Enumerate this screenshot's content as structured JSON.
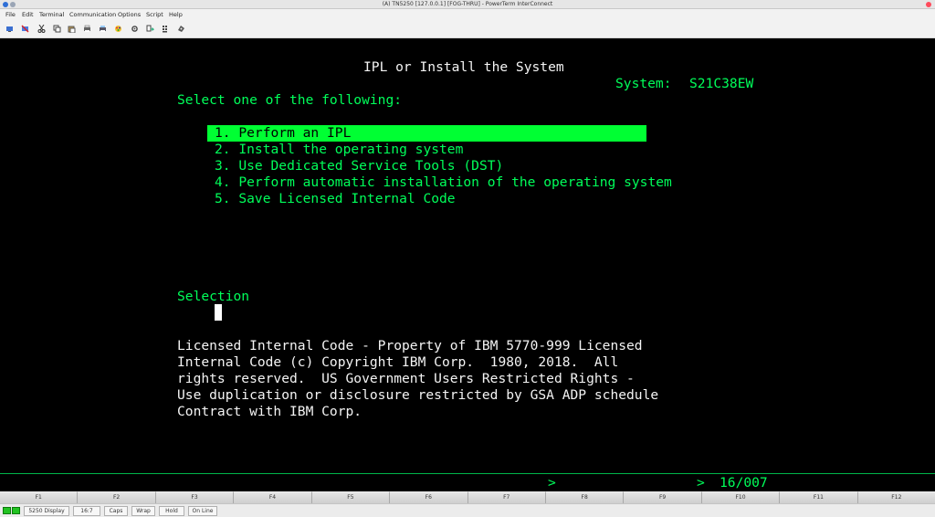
{
  "window": {
    "title": "(A) TN5250 [127.0.0.1] [FOG-THRU] - PowerTerm InterConnect"
  },
  "menu": [
    "File",
    "Edit",
    "Terminal",
    "Communication",
    "Options",
    "Script",
    "Help"
  ],
  "toolbar": {
    "icons": [
      "connect-icon",
      "disconnect-icon",
      "cut-icon",
      "copy-icon",
      "paste-icon",
      "print-icon",
      "print-screen-icon",
      "color-icon",
      "settings-icon",
      "file-transfer-icon",
      "keypad-icon",
      "macro-icon"
    ]
  },
  "screen": {
    "title": "IPL or Install the System",
    "system_label": "System:",
    "system_name": "S21C38EW",
    "prompt": "Select one of the following:",
    "options": [
      "1. Perform an IPL",
      "2. Install the operating system",
      "3. Use Dedicated Service Tools (DST)",
      "4. Perform automatic installation of the operating system",
      "5. Save Licensed Internal Code"
    ],
    "selection_label": "Selection",
    "copyright": [
      "Licensed Internal Code - Property of IBM 5770-999 Licensed",
      "Internal Code (c) Copyright IBM Corp.  1980, 2018.  All",
      "rights reserved.  US Government Users Restricted Rights -",
      "Use duplication or disclosure restricted by GSA ADP schedule",
      "Contract with IBM Corp."
    ]
  },
  "oia": {
    "arrow1": ">",
    "arrow2": ">",
    "position": "16/007"
  },
  "fkeys": [
    "F1",
    "F2",
    "F3",
    "F4",
    "F5",
    "F6",
    "F7",
    "F8",
    "F9",
    "F10",
    "F11",
    "F12"
  ],
  "statusbar": {
    "items": [
      "5250 Display",
      "16:7",
      "Caps",
      "Wrap",
      "Hold",
      "On Line"
    ]
  },
  "colors": {
    "terminal_green": "#00ff5a",
    "highlight": "#00ff33",
    "text_white": "#f4f4f4",
    "background": "#000000"
  }
}
